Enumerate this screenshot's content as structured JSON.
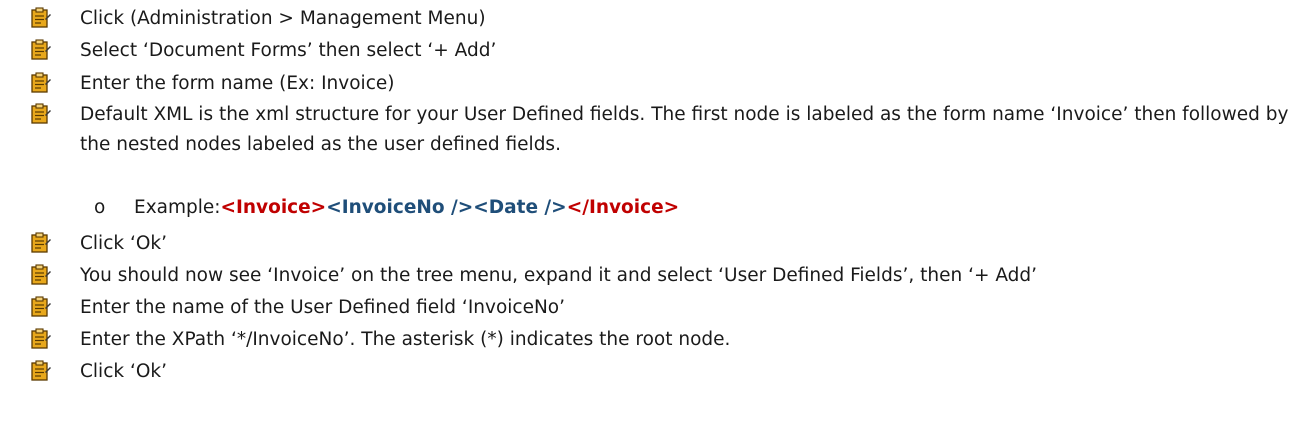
{
  "steps": [
    {
      "text": "Click (Administration > Management Menu)"
    },
    {
      "text": "Select ‘Document Forms’ then select ‘+ Add’"
    },
    {
      "text": "Enter the form name (Ex: Invoice)"
    },
    {
      "text": "Default XML is the xml structure for your User Defined fields. The first node is labeled as the form name ‘Invoice’ then followed by the nested nodes labeled as the user defined fields."
    },
    {
      "text": "Click ‘Ok’"
    },
    {
      "text": "You should now see ‘Invoice’ on the tree menu, expand it and select ‘User Defined Fields’, then ‘+ Add’"
    },
    {
      "text": "Enter the name of the User Defined field ‘InvoiceNo’"
    },
    {
      "text": "Enter the XPath ‘*/InvoiceNo’. The asterisk (*) indicates the root node."
    },
    {
      "text": "Click ‘Ok’"
    }
  ],
  "example": {
    "marker": "o",
    "label": "Example: ",
    "open_tag": "<Invoice>",
    "inner_tags": "<InvoiceNo /><Date />",
    "close_tag": "</Invoice>"
  },
  "colors": {
    "tag_red": "#c00000",
    "tag_blue": "#1f4e79",
    "bullet_fill": "#e8a81c"
  },
  "bullet_icon": "clipboard-icon"
}
